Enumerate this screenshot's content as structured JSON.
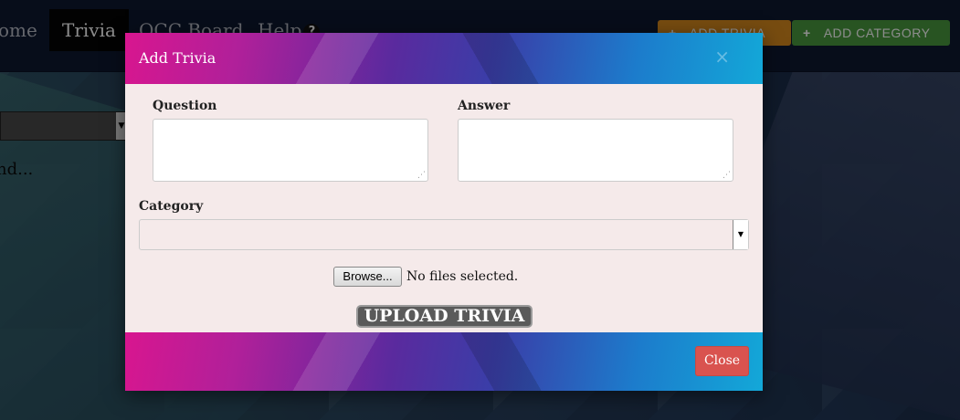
{
  "navbar": {
    "items": [
      {
        "label": "ome"
      },
      {
        "label": "Trivia"
      },
      {
        "label": "OCC Board"
      },
      {
        "label": "Help"
      }
    ],
    "help_badge": "?",
    "add_trivia_label": "ADD TRIVIA",
    "add_category_label": "ADD CATEGORY",
    "plus_glyph": "+"
  },
  "page": {
    "loading_text": "nd..."
  },
  "modal": {
    "title": "Add Trivia",
    "close_x": "×",
    "question_label": "Question",
    "answer_label": "Answer",
    "category_label": "Category",
    "category_value": "",
    "browse_label": "Browse...",
    "file_status": "No files selected.",
    "upload_label": "UPLOAD TRIVIA",
    "close_label": "Close"
  },
  "colors": {
    "add_trivia": "#d98a1e",
    "add_category": "#4a9a3e",
    "close_button": "#d9534f",
    "modal_body": "#f5eaea"
  },
  "icons": [
    "plus-icon",
    "help-icon",
    "close-icon",
    "dropdown-arrow-icon",
    "resize-grip-icon"
  ]
}
